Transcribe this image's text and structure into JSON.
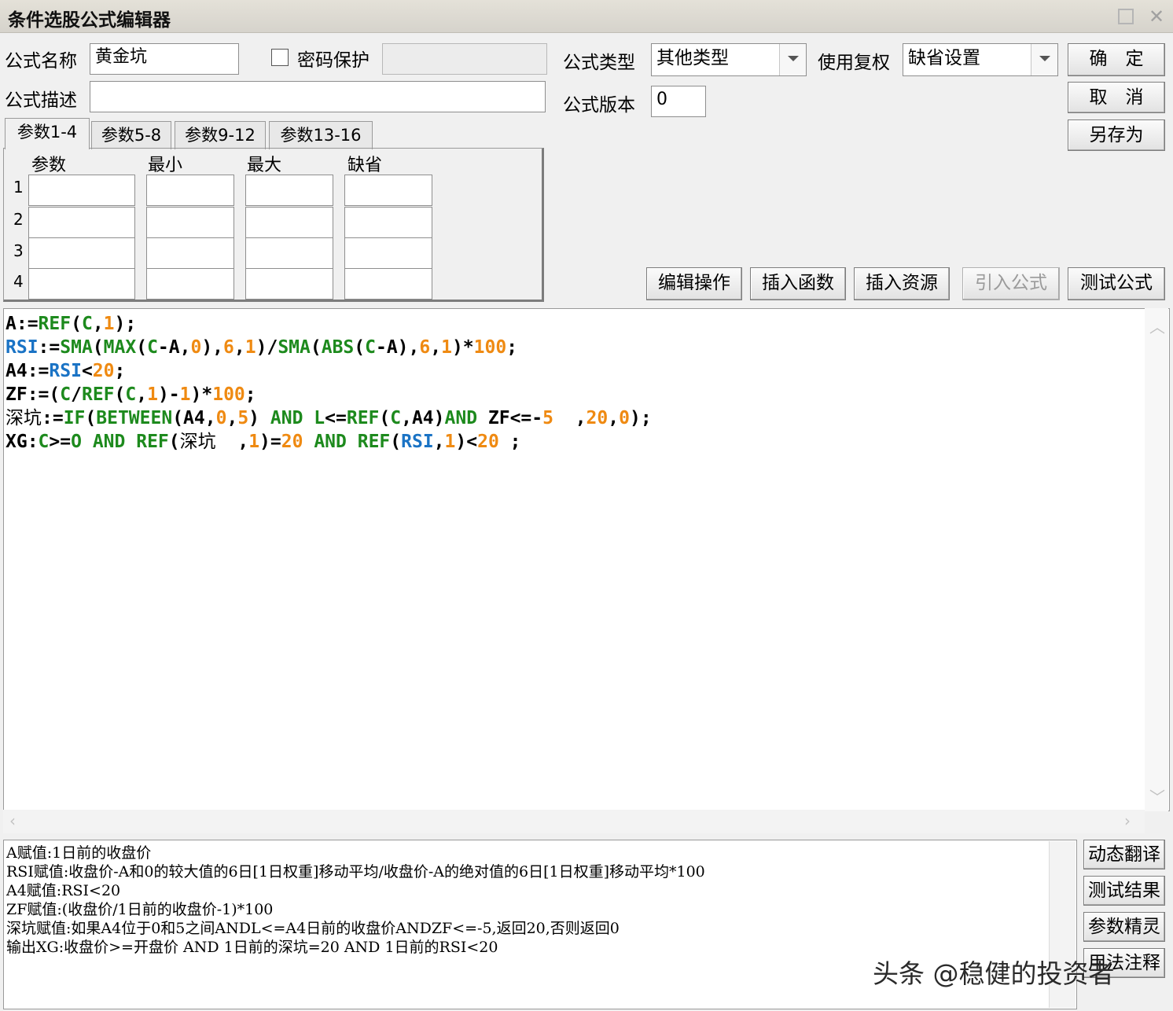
{
  "window": {
    "title": "条件选股公式编辑器"
  },
  "header": {
    "name_label": "公式名称",
    "name_value": "黄金坑",
    "password_label": "密码保护",
    "desc_label": "公式描述",
    "desc_value": "",
    "type_label": "公式类型",
    "type_value": "其他类型",
    "rights_label": "使用复权",
    "rights_value": "缺省设置",
    "version_label": "公式版本",
    "version_value": "0"
  },
  "right_buttons": {
    "ok": "确　定",
    "cancel": "取　消",
    "save_as": "另存为"
  },
  "tabs": [
    "参数1-4",
    "参数5-8",
    "参数9-12",
    "参数13-16"
  ],
  "params": {
    "headers": [
      "参数",
      "最小",
      "最大",
      "缺省"
    ],
    "rows": [
      "1",
      "2",
      "3",
      "4"
    ]
  },
  "toolbar": {
    "edit_ops": "编辑操作",
    "insert_func": "插入函数",
    "insert_res": "插入资源",
    "import_formula": "引入公式",
    "test_formula": "测试公式"
  },
  "code": [
    [
      [
        "k",
        "A:="
      ],
      [
        "f",
        "REF"
      ],
      [
        "k",
        "("
      ],
      [
        "f",
        "C"
      ],
      [
        "k",
        ","
      ],
      [
        "n",
        "1"
      ],
      [
        "k",
        ");"
      ]
    ],
    [
      [
        "v",
        "RSI"
      ],
      [
        "k",
        ":="
      ],
      [
        "f",
        "SMA"
      ],
      [
        "k",
        "("
      ],
      [
        "f",
        "MAX"
      ],
      [
        "k",
        "("
      ],
      [
        "f",
        "C"
      ],
      [
        "k",
        "-A,"
      ],
      [
        "n",
        "0"
      ],
      [
        "k",
        "),"
      ],
      [
        "n",
        "6"
      ],
      [
        "k",
        ","
      ],
      [
        "n",
        "1"
      ],
      [
        "k",
        ")/"
      ],
      [
        "f",
        "SMA"
      ],
      [
        "k",
        "("
      ],
      [
        "f",
        "ABS"
      ],
      [
        "k",
        "("
      ],
      [
        "f",
        "C"
      ],
      [
        "k",
        "-A),"
      ],
      [
        "n",
        "6"
      ],
      [
        "k",
        ","
      ],
      [
        "n",
        "1"
      ],
      [
        "k",
        ")*"
      ],
      [
        "n",
        "100"
      ],
      [
        "k",
        ";"
      ]
    ],
    [
      [
        "k",
        "A4:="
      ],
      [
        "v",
        "RSI"
      ],
      [
        "k",
        "<"
      ],
      [
        "n",
        "20"
      ],
      [
        "k",
        ";"
      ]
    ],
    [
      [
        "k",
        "ZF:=("
      ],
      [
        "f",
        "C"
      ],
      [
        "k",
        "/"
      ],
      [
        "f",
        "REF"
      ],
      [
        "k",
        "("
      ],
      [
        "f",
        "C"
      ],
      [
        "k",
        ","
      ],
      [
        "n",
        "1"
      ],
      [
        "k",
        ")-"
      ],
      [
        "n",
        "1"
      ],
      [
        "k",
        ")*"
      ],
      [
        "n",
        "100"
      ],
      [
        "k",
        ";"
      ]
    ],
    [
      [
        "cn",
        "深坑"
      ],
      [
        "k",
        ":="
      ],
      [
        "f",
        "IF"
      ],
      [
        "k",
        "("
      ],
      [
        "f",
        "BETWEEN"
      ],
      [
        "k",
        "(A4,"
      ],
      [
        "n",
        "0"
      ],
      [
        "k",
        ","
      ],
      [
        "n",
        "5"
      ],
      [
        "k",
        ") "
      ],
      [
        "f",
        "AND"
      ],
      [
        "k",
        " "
      ],
      [
        "f",
        "L"
      ],
      [
        "k",
        "<="
      ],
      [
        "f",
        "REF"
      ],
      [
        "k",
        "("
      ],
      [
        "f",
        "C"
      ],
      [
        "k",
        ",A4)"
      ],
      [
        "f",
        "AND"
      ],
      [
        "k",
        " ZF<=-"
      ],
      [
        "n",
        "5"
      ],
      [
        "k",
        "  ,"
      ],
      [
        "n",
        "20"
      ],
      [
        "k",
        ","
      ],
      [
        "n",
        "0"
      ],
      [
        "k",
        ");"
      ]
    ],
    [
      [
        "k",
        "XG:"
      ],
      [
        "f",
        "C"
      ],
      [
        "k",
        ">="
      ],
      [
        "f",
        "O"
      ],
      [
        "k",
        " "
      ],
      [
        "f",
        "AND"
      ],
      [
        "k",
        " "
      ],
      [
        "f",
        "REF"
      ],
      [
        "k",
        "("
      ],
      [
        "cn",
        "深坑"
      ],
      [
        "k",
        "  ,"
      ],
      [
        "n",
        "1"
      ],
      [
        "k",
        ")="
      ],
      [
        "n",
        "20"
      ],
      [
        "k",
        " "
      ],
      [
        "f",
        "AND"
      ],
      [
        "k",
        " "
      ],
      [
        "f",
        "REF"
      ],
      [
        "k",
        "("
      ],
      [
        "v",
        "RSI"
      ],
      [
        "k",
        ","
      ],
      [
        "n",
        "1"
      ],
      [
        "k",
        ")<"
      ],
      [
        "n",
        "20"
      ],
      [
        "k",
        " ;"
      ]
    ]
  ],
  "explanation": [
    "A赋值:1日前的收盘价",
    "RSI赋值:收盘价-A和0的较大值的6日[1日权重]移动平均/收盘价-A的绝对值的6日[1日权重]移动平均*100",
    "A4赋值:RSI<20",
    "ZF赋值:(收盘价/1日前的收盘价-1)*100",
    "深坑赋值:如果A4位于0和5之间ANDL<=A4日前的收盘价ANDZF<=-5,返回20,否则返回0",
    "输出XG:收盘价>=开盘价 AND 1日前的深坑=20 AND 1日前的RSI<20"
  ],
  "side_buttons": {
    "dynamic": "动态翻译",
    "test_result": "测试结果",
    "param_wizard": "参数精灵",
    "usage_note": "用法注释"
  },
  "watermark": "头条 @稳健的投资者",
  "colors": {
    "function": "#1d8a1d",
    "number": "#ef8a12",
    "variable": "#1a73c5",
    "keyword": "#000000"
  }
}
